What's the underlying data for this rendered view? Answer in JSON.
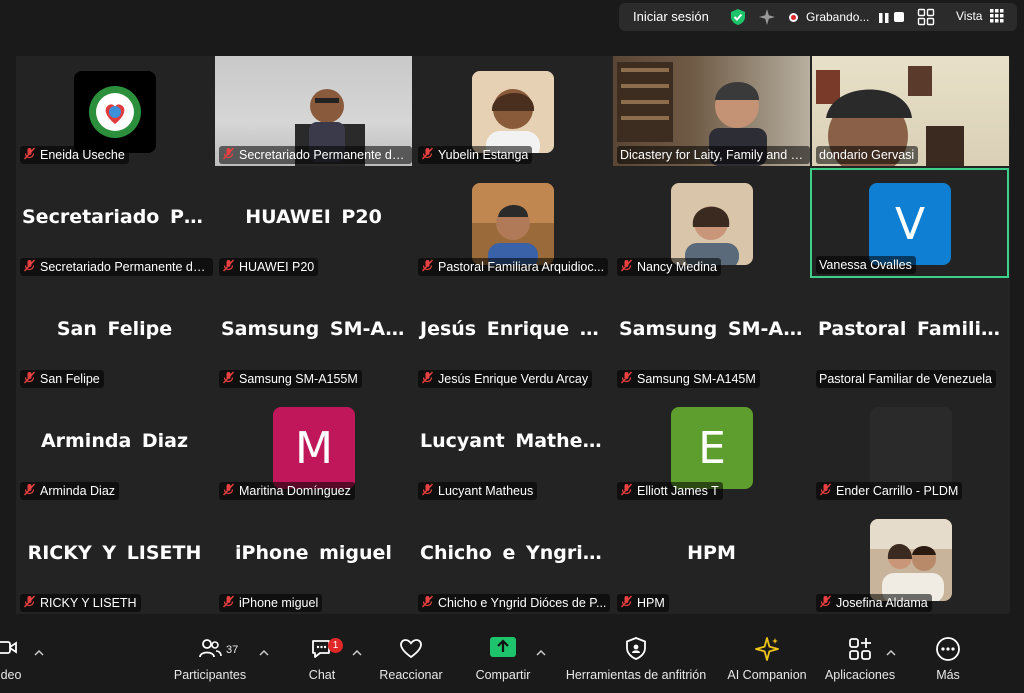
{
  "topbar": {
    "signin": "Iniciar sesión",
    "recording": "Grabando...",
    "view": "Vista",
    "colors": {
      "shield": "#1ec46b",
      "record": "#e02828"
    }
  },
  "tiles": [
    {
      "tag": "Eneida Useche",
      "type": "logo"
    },
    {
      "tag": "Secretariado Permanente de...",
      "type": "video"
    },
    {
      "tag": "Yubelin Estanga",
      "type": "photo"
    },
    {
      "tag": "Dicastery for Laity, Family and L...",
      "type": "video"
    },
    {
      "tag": "dondario Gervasi",
      "type": "video"
    },
    {
      "tag": "Secretariado Permanente de...",
      "big": "Secretariado Pe..."
    },
    {
      "tag": "HUAWEI P20",
      "big": "HUAWEI P20"
    },
    {
      "tag": "Pastoral Familiara Arquidioc...",
      "type": "photo"
    },
    {
      "tag": "Nancy Medina",
      "type": "photo"
    },
    {
      "tag": "Vanessa Ovalles",
      "initial": "V",
      "color": "#0e7fd2",
      "active": true
    },
    {
      "tag": "San Felipe",
      "big": "San Felipe"
    },
    {
      "tag": "Samsung SM-A155M",
      "big": "Samsung SM-A..."
    },
    {
      "tag": "Jesús Enrique Verdu Arcay",
      "big": "Jesús Enrique V..."
    },
    {
      "tag": "Samsung SM-A145M",
      "big": "Samsung SM-A..."
    },
    {
      "tag": "Pastoral Familiar de Venezuela",
      "big": "Pastoral Familia..."
    },
    {
      "tag": "Arminda Diaz",
      "big": "Arminda Diaz"
    },
    {
      "tag": "Maritina Domínguez",
      "initial": "M",
      "color": "#c0175a"
    },
    {
      "tag": "Lucyant Matheus",
      "big": "Lucyant Matheus"
    },
    {
      "tag": "Elliott James T",
      "initial": "E",
      "color": "#5e9e2e"
    },
    {
      "tag": "Ender Carrillo - PLDM",
      "initial": "",
      "color": "#242424"
    },
    {
      "tag": "RICKY Y LISETH",
      "big": "RICKY Y LISETH"
    },
    {
      "tag": "iPhone miguel",
      "big": "iPhone miguel"
    },
    {
      "tag": "Chicho e Yngrid Dióces de P...",
      "big": "Chicho e Yngrid..."
    },
    {
      "tag": "HPM",
      "big": "HPM"
    },
    {
      "tag": "Josefina Aldama",
      "type": "photo"
    }
  ],
  "toolbar": {
    "video": "deo",
    "participants": "Participantes",
    "participants_count": "37",
    "chat": "Chat",
    "chat_badge": "1",
    "react": "Reaccionar",
    "share": "Compartir",
    "host_tools": "Herramientas de anfitrión",
    "ai": "AI Companion",
    "apps": "Aplicaciones",
    "more": "Más",
    "colors": {
      "share": "#1ec46b",
      "ai": "#f0c419"
    }
  }
}
